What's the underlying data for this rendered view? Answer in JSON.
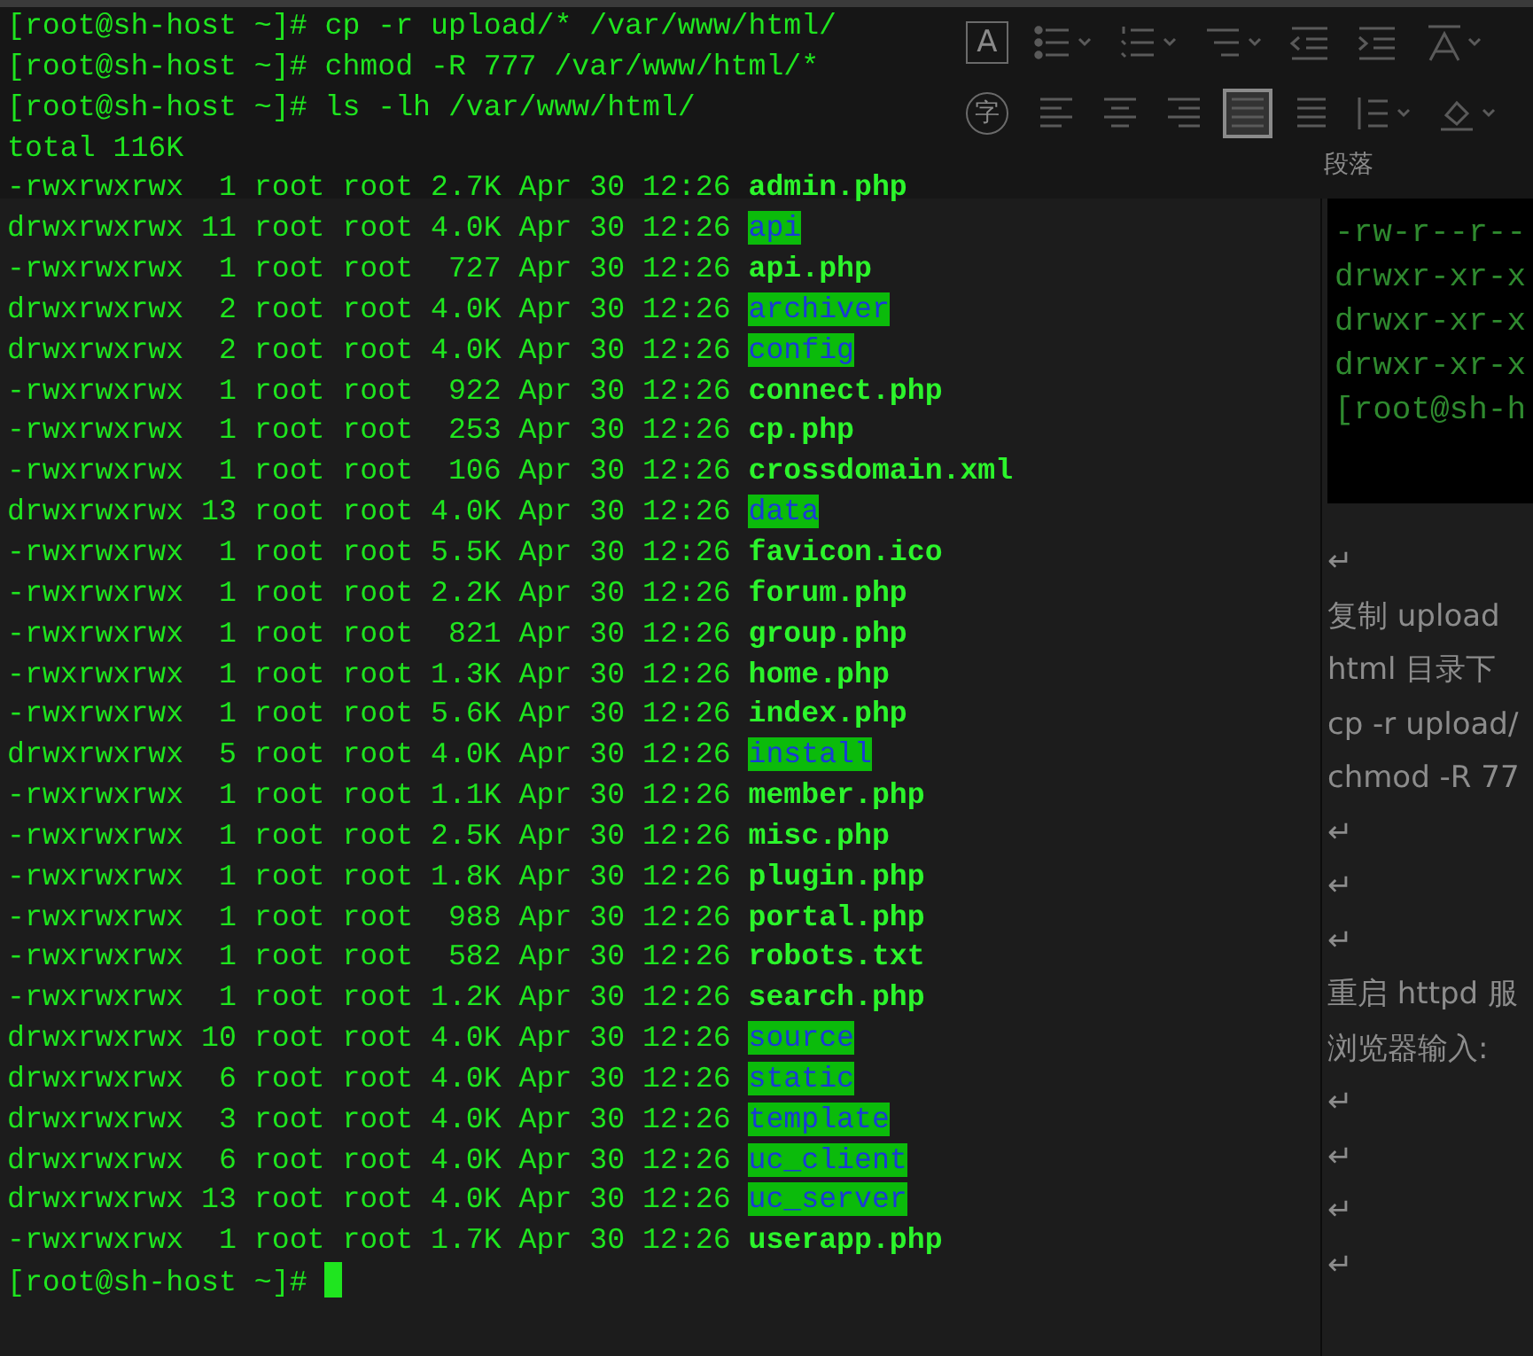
{
  "terminal": {
    "commands": [
      "[root@sh-host ~]# cp -r upload/* /var/www/html/",
      "[root@sh-host ~]# chmod -R 777 /var/www/html/*",
      "[root@sh-host ~]# ls -lh /var/www/html/"
    ],
    "total": "total 116K",
    "entries": [
      {
        "meta": "-rwxrwxrwx  1 root root 2.7K Apr 30 12:26",
        "name": "admin.php",
        "kind": "file"
      },
      {
        "meta": "drwxrwxrwx 11 root root 4.0K Apr 30 12:26",
        "name": "api",
        "kind": "dir"
      },
      {
        "meta": "-rwxrwxrwx  1 root root  727 Apr 30 12:26",
        "name": "api.php",
        "kind": "file"
      },
      {
        "meta": "drwxrwxrwx  2 root root 4.0K Apr 30 12:26",
        "name": "archiver",
        "kind": "dir"
      },
      {
        "meta": "drwxrwxrwx  2 root root 4.0K Apr 30 12:26",
        "name": "config",
        "kind": "dir"
      },
      {
        "meta": "-rwxrwxrwx  1 root root  922 Apr 30 12:26",
        "name": "connect.php",
        "kind": "file"
      },
      {
        "meta": "-rwxrwxrwx  1 root root  253 Apr 30 12:26",
        "name": "cp.php",
        "kind": "file"
      },
      {
        "meta": "-rwxrwxrwx  1 root root  106 Apr 30 12:26",
        "name": "crossdomain.xml",
        "kind": "file"
      },
      {
        "meta": "drwxrwxrwx 13 root root 4.0K Apr 30 12:26",
        "name": "data",
        "kind": "dir"
      },
      {
        "meta": "-rwxrwxrwx  1 root root 5.5K Apr 30 12:26",
        "name": "favicon.ico",
        "kind": "file"
      },
      {
        "meta": "-rwxrwxrwx  1 root root 2.2K Apr 30 12:26",
        "name": "forum.php",
        "kind": "file"
      },
      {
        "meta": "-rwxrwxrwx  1 root root  821 Apr 30 12:26",
        "name": "group.php",
        "kind": "file"
      },
      {
        "meta": "-rwxrwxrwx  1 root root 1.3K Apr 30 12:26",
        "name": "home.php",
        "kind": "file"
      },
      {
        "meta": "-rwxrwxrwx  1 root root 5.6K Apr 30 12:26",
        "name": "index.php",
        "kind": "file"
      },
      {
        "meta": "drwxrwxrwx  5 root root 4.0K Apr 30 12:26",
        "name": "install",
        "kind": "dir"
      },
      {
        "meta": "-rwxrwxrwx  1 root root 1.1K Apr 30 12:26",
        "name": "member.php",
        "kind": "file"
      },
      {
        "meta": "-rwxrwxrwx  1 root root 2.5K Apr 30 12:26",
        "name": "misc.php",
        "kind": "file"
      },
      {
        "meta": "-rwxrwxrwx  1 root root 1.8K Apr 30 12:26",
        "name": "plugin.php",
        "kind": "file"
      },
      {
        "meta": "-rwxrwxrwx  1 root root  988 Apr 30 12:26",
        "name": "portal.php",
        "kind": "file"
      },
      {
        "meta": "-rwxrwxrwx  1 root root  582 Apr 30 12:26",
        "name": "robots.txt",
        "kind": "file"
      },
      {
        "meta": "-rwxrwxrwx  1 root root 1.2K Apr 30 12:26",
        "name": "search.php",
        "kind": "file"
      },
      {
        "meta": "drwxrwxrwx 10 root root 4.0K Apr 30 12:26",
        "name": "source",
        "kind": "dir"
      },
      {
        "meta": "drwxrwxrwx  6 root root 4.0K Apr 30 12:26",
        "name": "static",
        "kind": "dir"
      },
      {
        "meta": "drwxrwxrwx  3 root root 4.0K Apr 30 12:26",
        "name": "template",
        "kind": "dir"
      },
      {
        "meta": "drwxrwxrwx  6 root root 4.0K Apr 30 12:26",
        "name": "uc_client",
        "kind": "dir"
      },
      {
        "meta": "drwxrwxrwx 13 root root 4.0K Apr 30 12:26",
        "name": "uc_server",
        "kind": "dir"
      },
      {
        "meta": "-rwxrwxrwx  1 root root 1.7K Apr 30 12:26",
        "name": "userapp.php",
        "kind": "file"
      }
    ],
    "prompt": "[root@sh-host ~]#"
  },
  "ribbon": {
    "char_buttons": [
      "A",
      "字"
    ],
    "alignments": [
      {
        "kind": "left",
        "selected": false
      },
      {
        "kind": "center",
        "selected": false
      },
      {
        "kind": "right",
        "selected": false
      },
      {
        "kind": "justify",
        "selected": true
      },
      {
        "kind": "distributed",
        "selected": false
      }
    ],
    "group_label": "段落"
  },
  "document": {
    "screenshot_lines": [
      "-rw-r--r--",
      "drwxr-xr-x",
      "drwxr-xr-x",
      "drwxr-xr-x",
      "[root@sh-h"
    ],
    "lines": [
      "↵",
      "复制 upload",
      "html 目录下",
      "cp -r upload/",
      "chmod -R 77",
      "↵",
      "↵",
      "↵",
      "重启 httpd 服",
      "浏览器输入:",
      "↵",
      "↵",
      "↵",
      "↵"
    ]
  }
}
